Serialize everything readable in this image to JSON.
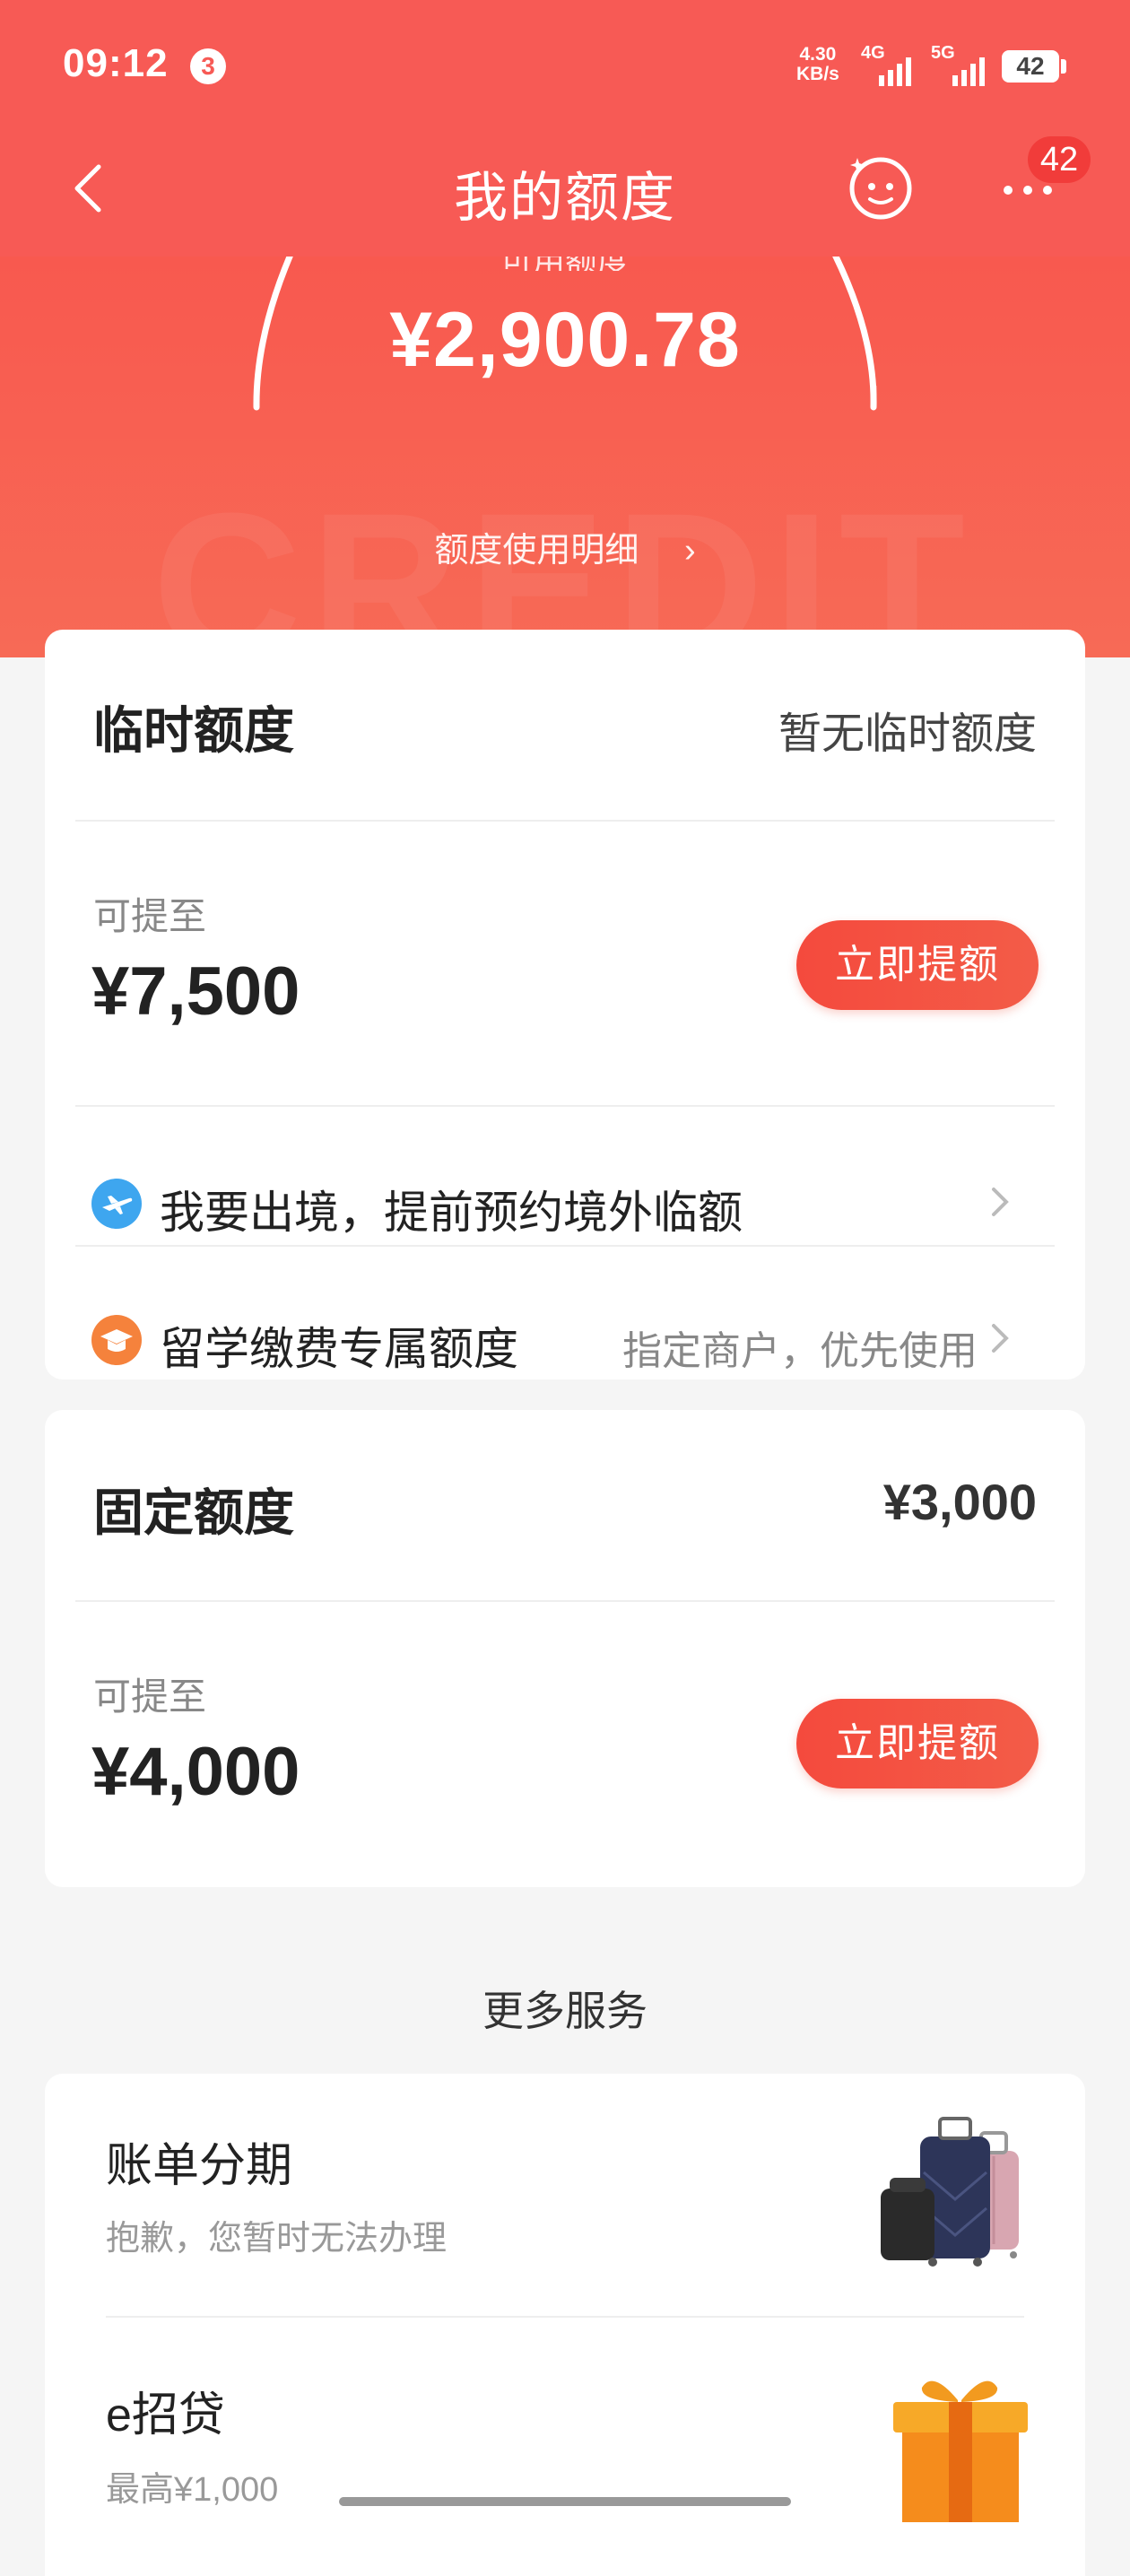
{
  "status_bar": {
    "time": "09:12",
    "notification_count": "3",
    "net_speed_value": "4.30",
    "net_speed_unit": "KB/s",
    "signal1_label": "4G",
    "signal2_label": "5G",
    "battery": "42"
  },
  "nav": {
    "title": "我的额度",
    "more_badge": "42"
  },
  "hero": {
    "available_label": "可用额度",
    "available_amount": "¥2,900.78",
    "detail_link": "额度使用明细",
    "watermark": "CREDIT"
  },
  "temporary_credit": {
    "title": "临时额度",
    "status": "暂无临时额度",
    "raise_label": "可提至",
    "raise_amount": "¥7,500",
    "raise_button": "立即提额",
    "abroad_row": "我要出境，提前预约境外临额",
    "study_row": "留学缴费专属额度",
    "study_hint": "指定商户，优先使用"
  },
  "fixed_credit": {
    "title": "固定额度",
    "amount": "¥3,000",
    "raise_label": "可提至",
    "raise_amount": "¥4,000",
    "raise_button": "立即提额"
  },
  "more_services": {
    "heading": "更多服务",
    "items": [
      {
        "title": "账单分期",
        "subtitle": "抱歉，您暂时无法办理",
        "icon": "luggage-icon"
      },
      {
        "title": "e招贷",
        "subtitle": "最高¥1,000",
        "icon": "gift-box-icon"
      }
    ]
  },
  "colors": {
    "brand_red": "#f75a55",
    "button_red": "#f44a3d"
  }
}
